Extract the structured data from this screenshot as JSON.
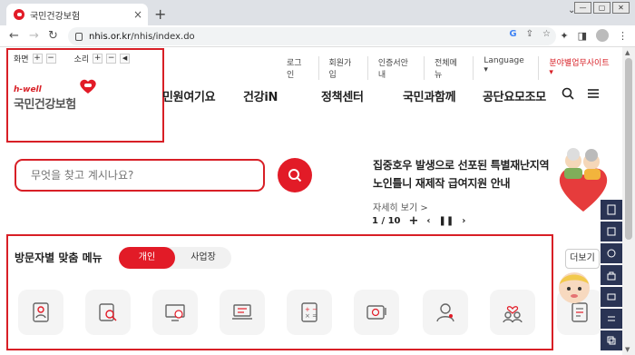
{
  "browser": {
    "tab_title": "국민건강보험",
    "tab_close": "×",
    "new_tab": "+",
    "url_host": "nhis.or.kr",
    "url_path": "/nhis/index.do"
  },
  "accessibility": {
    "zoom_label": "화면",
    "sound_label": "소리",
    "plus": "+",
    "minus": "−"
  },
  "logo": {
    "hwell": "h-well",
    "name": "국민건강보험"
  },
  "util_menu": [
    "로그인",
    "회원가입",
    "인증서안내",
    "전체메뉴",
    "Language ▾",
    "분야별업무사이트 ▾"
  ],
  "gnb": [
    "민원여기요",
    "건강iN",
    "정책센터",
    "국민과함께",
    "공단요모조모"
  ],
  "search": {
    "placeholder": "무엇을 찾고 계시나요?"
  },
  "news": {
    "line1": "집중호우 발생으로 선포된 특별재난지역",
    "line2": "노인틀니 재제작 급여지원 안내",
    "more": "자세히 보기 >",
    "page": "1 / 10",
    "plus": "+"
  },
  "visitor_menu": {
    "title": "방문자별 맞춤 메뉴",
    "tab_personal": "개인",
    "tab_business": "사업장",
    "more": "더보기"
  },
  "colors": {
    "accent": "#e21b27",
    "quick_bar": "#2a3454"
  },
  "icons": [
    "id-card-icon",
    "search-doc-icon",
    "monitor-won-icon",
    "laptop-list-icon",
    "calculator-doc-icon",
    "payment-icon",
    "support-person-icon",
    "care-people-icon",
    "form-doc-icon"
  ]
}
